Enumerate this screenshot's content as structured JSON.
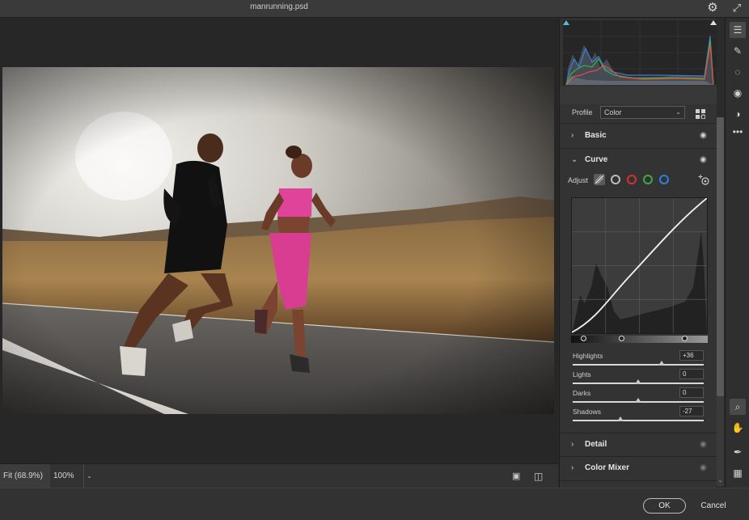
{
  "window": {
    "title": "manrunning.psd"
  },
  "zoom": {
    "fit_label": "Fit (68.9%)",
    "level_label": "100%"
  },
  "profile": {
    "label": "Profile",
    "value": "Color"
  },
  "panels": {
    "basic": "Basic",
    "curve": "Curve",
    "detail": "Detail",
    "color_mixer": "Color Mixer"
  },
  "curve": {
    "adjust_label": "Adjust",
    "channels": [
      "parametric",
      "point",
      "red",
      "green",
      "blue"
    ],
    "channel_colors": {
      "point": "#bdbdbd",
      "red": "#d9322b",
      "green": "#3ea84a",
      "blue": "#2f7fe0"
    }
  },
  "sliders": [
    {
      "label": "Highlights",
      "value": "+36",
      "level": 0.68
    },
    {
      "label": "Lights",
      "value": "0",
      "level": 0.5
    },
    {
      "label": "Darks",
      "value": "0",
      "level": 0.5
    },
    {
      "label": "Shadows",
      "value": "-27",
      "level": 0.365
    }
  ],
  "footer": {
    "ok": "OK",
    "cancel": "Cancel"
  },
  "icons": {
    "titlebar": [
      "gear-icon",
      "expand-icon"
    ],
    "tools": [
      "edit-sliders-icon",
      "healing-icon",
      "masking-icon",
      "red-eye-icon",
      "presets-icon",
      "more-icon",
      "zoom-icon",
      "hand-icon",
      "color-sampler-icon",
      "grid-overlay-icon"
    ]
  }
}
